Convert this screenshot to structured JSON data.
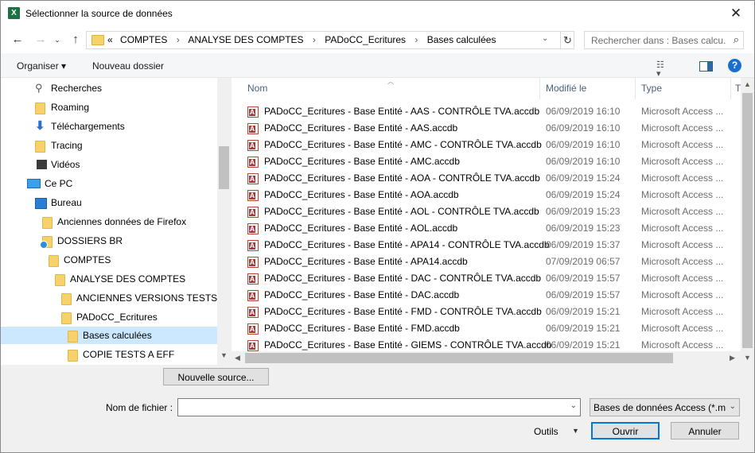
{
  "window": {
    "title": "Sélectionner la source de données",
    "close": "✕"
  },
  "address": {
    "prefix": "«",
    "crumbs": [
      "COMPTES",
      "ANALYSE DES COMPTES",
      "PADoCC_Ecritures",
      "Bases calculées"
    ],
    "separator": "›"
  },
  "search": {
    "placeholder": "Rechercher dans : Bases calcu..."
  },
  "toolbar": {
    "organize": "Organiser ▾",
    "new_folder": "Nouveau dossier",
    "help": "?"
  },
  "nav": {
    "items": [
      {
        "label": "Recherches",
        "icon": "search-icon"
      },
      {
        "label": "Roaming",
        "icon": "folder-icon"
      },
      {
        "label": "Téléchargements",
        "icon": "download-icon"
      },
      {
        "label": "Tracing",
        "icon": "folder-icon"
      },
      {
        "label": "Vidéos",
        "icon": "video-icon"
      },
      {
        "label": "Ce PC",
        "icon": "computer-icon"
      },
      {
        "label": "Bureau",
        "icon": "desktop-folder-icon"
      },
      {
        "label": "Anciennes données de Firefox",
        "icon": "folder-icon"
      },
      {
        "label": "DOSSIERS BR",
        "icon": "synced-folder-icon"
      },
      {
        "label": "COMPTES",
        "icon": "folder-icon"
      },
      {
        "label": "ANALYSE DES COMPTES",
        "icon": "folder-icon"
      },
      {
        "label": "ANCIENNES VERSIONS TESTS",
        "icon": "folder-icon"
      },
      {
        "label": "PADoCC_Ecritures",
        "icon": "folder-icon"
      },
      {
        "label": "Bases calculées",
        "icon": "folder-icon",
        "selected": true
      },
      {
        "label": "COPIE TESTS A EFF",
        "icon": "folder-icon"
      }
    ]
  },
  "files": {
    "columns": {
      "name": "Nom",
      "modified": "Modifié le",
      "type": "Type",
      "more": "T"
    },
    "rows": [
      {
        "name": "PADoCC_Ecritures - Base Entité - AAS - CONTRÔLE TVA.accdb",
        "date": "06/09/2019 16:10",
        "type": "Microsoft Access ..."
      },
      {
        "name": "PADoCC_Ecritures - Base Entité - AAS.accdb",
        "date": "06/09/2019 16:10",
        "type": "Microsoft Access ..."
      },
      {
        "name": "PADoCC_Ecritures - Base Entité - AMC - CONTRÔLE TVA.accdb",
        "date": "06/09/2019 16:10",
        "type": "Microsoft Access ..."
      },
      {
        "name": "PADoCC_Ecritures - Base Entité - AMC.accdb",
        "date": "06/09/2019 16:10",
        "type": "Microsoft Access ..."
      },
      {
        "name": "PADoCC_Ecritures - Base Entité - AOA - CONTRÔLE TVA.accdb",
        "date": "06/09/2019 15:24",
        "type": "Microsoft Access ..."
      },
      {
        "name": "PADoCC_Ecritures - Base Entité - AOA.accdb",
        "date": "06/09/2019 15:24",
        "type": "Microsoft Access ..."
      },
      {
        "name": "PADoCC_Ecritures - Base Entité - AOL - CONTRÔLE TVA.accdb",
        "date": "06/09/2019 15:23",
        "type": "Microsoft Access ..."
      },
      {
        "name": "PADoCC_Ecritures - Base Entité - AOL.accdb",
        "date": "06/09/2019 15:23",
        "type": "Microsoft Access ..."
      },
      {
        "name": "PADoCC_Ecritures - Base Entité - APA14 - CONTRÔLE TVA.accdb",
        "date": "06/09/2019 15:37",
        "type": "Microsoft Access ..."
      },
      {
        "name": "PADoCC_Ecritures - Base Entité - APA14.accdb",
        "date": "07/09/2019 06:57",
        "type": "Microsoft Access ..."
      },
      {
        "name": "PADoCC_Ecritures - Base Entité - DAC - CONTRÔLE TVA.accdb",
        "date": "06/09/2019 15:57",
        "type": "Microsoft Access ..."
      },
      {
        "name": "PADoCC_Ecritures - Base Entité - DAC.accdb",
        "date": "06/09/2019 15:57",
        "type": "Microsoft Access ..."
      },
      {
        "name": "PADoCC_Ecritures - Base Entité - FMD - CONTRÔLE TVA.accdb",
        "date": "06/09/2019 15:21",
        "type": "Microsoft Access ..."
      },
      {
        "name": "PADoCC_Ecritures - Base Entité - FMD.accdb",
        "date": "06/09/2019 15:21",
        "type": "Microsoft Access ..."
      },
      {
        "name": "PADoCC_Ecritures - Base Entité - GIEMS - CONTRÔLE TVA.accdb",
        "date": "06/09/2019 15:21",
        "type": "Microsoft Access ..."
      }
    ]
  },
  "bottom": {
    "new_source": "Nouvelle source...",
    "filename_label": "Nom de fichier :",
    "filename_value": "",
    "filter": "Bases de données Access (*.md",
    "tools": "Outils",
    "open": "Ouvrir",
    "cancel": "Annuler"
  }
}
